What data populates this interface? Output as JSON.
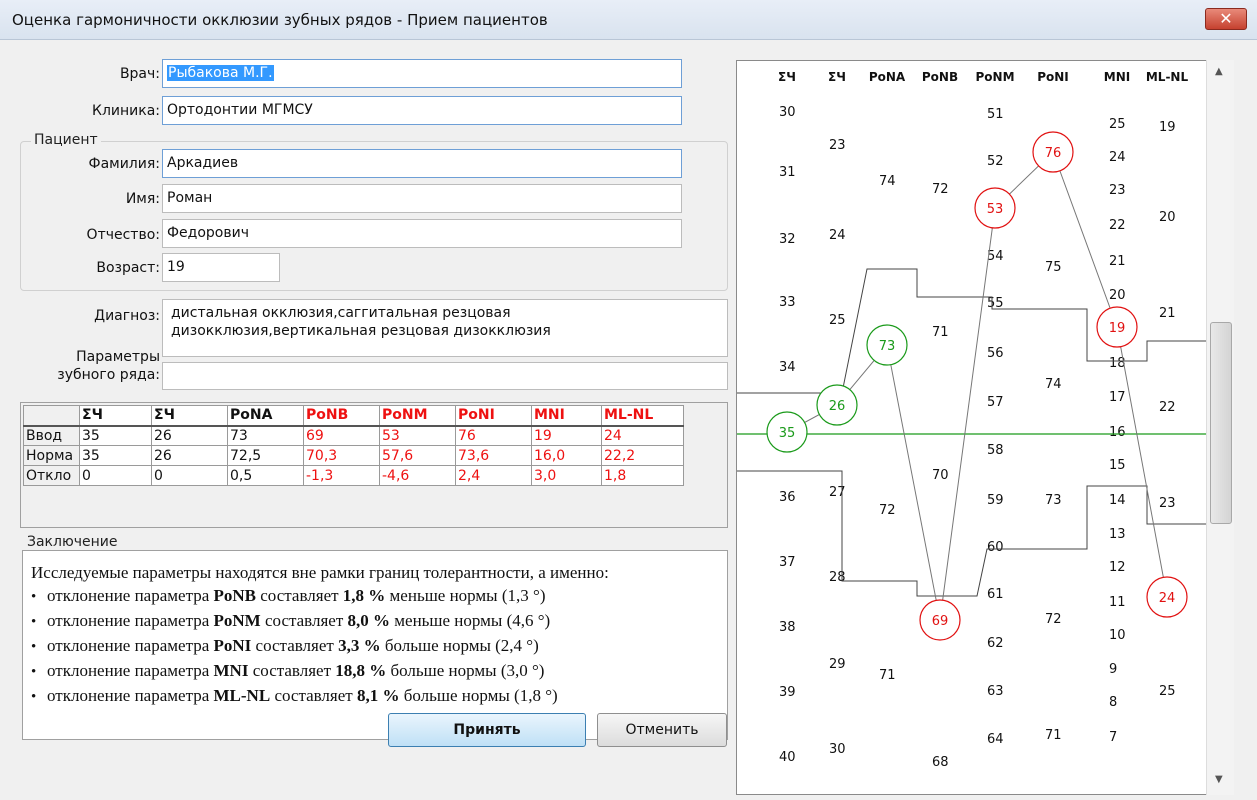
{
  "window": {
    "title": "Оценка гармоничности окклюзии зубных рядов - Прием пациентов",
    "close_glyph": "✕"
  },
  "form": {
    "doctor_label": "Врач:",
    "doctor_value": "Рыбакова М.Г.",
    "clinic_label": "Клиника:",
    "clinic_value": "Ортодонтии МГМСУ",
    "patient_group": "Пациент",
    "surname_label": "Фамилия:",
    "surname_value": "Аркадиев",
    "name_label": "Имя:",
    "name_value": "Роман",
    "patronymic_label": "Отчество:",
    "patronymic_value": "Федорович",
    "age_label": "Возраст:",
    "age_value": "19",
    "diagnosis_label": "Диагноз:",
    "diagnosis_line1": "дистальная окклюзия,саггитальная резцовая",
    "diagnosis_line2": "дизокклюзия,вертикальная резцовая дизокклюзия",
    "params_label_1": "Параметры",
    "params_label_2": "зубного ряда:",
    "params_value": ""
  },
  "table": {
    "headers": [
      "ΣЧ",
      "ΣЧ",
      "PoNA",
      "PoNB",
      "PoNM",
      "PoNI",
      "MNI",
      "ML-NL"
    ],
    "rows": [
      {
        "label": "Ввод",
        "values": [
          "35",
          "26",
          "73",
          "69",
          "53",
          "76",
          "19",
          "24"
        ]
      },
      {
        "label": "Норма",
        "values": [
          "35",
          "26",
          "72,5",
          "70,3",
          "57,6",
          "73,6",
          "16,0",
          "22,2"
        ]
      },
      {
        "label": "Откло",
        "values": [
          "0",
          "0",
          "0,5",
          "-1,3",
          "-4,6",
          "2,4",
          "3,0",
          "1,8"
        ]
      }
    ]
  },
  "conclusion": {
    "group_title": "Заключение",
    "intro": "Исследуемые параметры находятся вне рамки границ толерантности, а именно:",
    "items": [
      {
        "pre": "отклонение параметра ",
        "param": "PoNB",
        "mid": " составляет ",
        "pct": "1,8 %",
        "post": " меньше нормы (1,3 °)"
      },
      {
        "pre": "отклонение параметра ",
        "param": "PoNM",
        "mid": " составляет ",
        "pct": "8,0 %",
        "post": " меньше нормы (4,6 °)"
      },
      {
        "pre": "отклонение параметра ",
        "param": "PoNI",
        "mid": " составляет ",
        "pct": "3,3 %",
        "post": " больше нормы (2,4 °)"
      },
      {
        "pre": "отклонение параметра ",
        "param": "MNI",
        "mid": " составляет ",
        "pct": "18,8 %",
        "post": " больше нормы (3,0 °)"
      },
      {
        "pre": "отклонение параметра ",
        "param": "ML-NL",
        "mid": " составляет ",
        "pct": "8,1 %",
        "post": " больше нормы (1,8 °)"
      }
    ]
  },
  "buttons": {
    "ok": "Принять",
    "cancel": "Отменить"
  },
  "chart_data": {
    "type": "line",
    "title": "",
    "columns": [
      "ΣЧ",
      "ΣЧ",
      "PoNA",
      "PoNB",
      "PoNM",
      "PoNI",
      "MNI",
      "ML-NL"
    ],
    "visible_scale_labels": [
      [
        "30",
        "31",
        "32",
        "33",
        "34",
        "35",
        "36",
        "37",
        "38",
        "39",
        "40"
      ],
      [
        "23",
        "24",
        "25",
        "26",
        "27",
        "28",
        "29",
        "30"
      ],
      [
        "74",
        "73",
        "72",
        "71"
      ],
      [
        "72",
        "71",
        "70",
        "69",
        "68"
      ],
      [
        "51",
        "52",
        "53",
        "54",
        "55",
        "56",
        "57",
        "58",
        "59",
        "60",
        "61",
        "62",
        "63",
        "64"
      ],
      [
        "76",
        "75",
        "74",
        "73",
        "72",
        "71"
      ],
      [
        "25",
        "24",
        "23",
        "22",
        "21",
        "20",
        "19",
        "18",
        "17",
        "16",
        "15",
        "14",
        "13",
        "12",
        "11",
        "10",
        "9",
        "8",
        "7"
      ],
      [
        "19",
        "20",
        "21",
        "22",
        "23",
        "24",
        "25"
      ]
    ],
    "input_values": [
      35,
      26,
      73,
      69,
      53,
      76,
      19,
      24
    ],
    "within_norm_flags": [
      true,
      true,
      true,
      false,
      false,
      false,
      false,
      false
    ],
    "colors": {
      "within": "#1a9a1a",
      "outside": "#e11111",
      "norm_line": "#1a9a1a",
      "tolerance": "#444444"
    }
  }
}
